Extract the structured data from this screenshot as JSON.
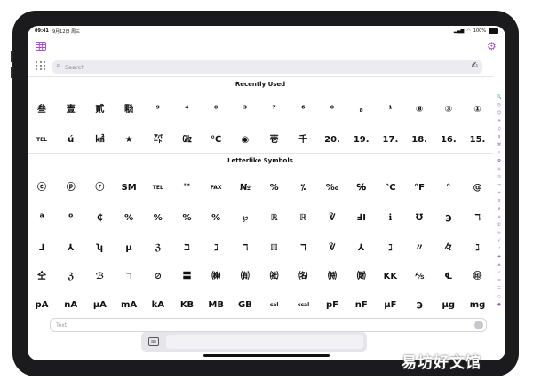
{
  "status_bar": {
    "time": "09:41",
    "date": "9月12日 周三",
    "battery": "100%"
  },
  "toolbar": {
    "left_icon": "table-icon",
    "right_icon": "gear-icon"
  },
  "search": {
    "placeholder": "Search",
    "value": ""
  },
  "sections": [
    {
      "title": "Recently Used",
      "rows": [
        [
          "叁",
          "壹",
          "貳",
          "㍾",
          "⁹",
          "⁴",
          "⁸",
          "³",
          "⁷",
          "⁶",
          "⁰",
          "₈",
          "¹",
          "⑧",
          "③",
          "①"
        ],
        [
          "TEL",
          "ú",
          "㎢",
          "★",
          "㌀",
          "㎓",
          "℃",
          "◉",
          "壱",
          "千",
          "20.",
          "19.",
          "17.",
          "18.",
          "16.",
          "15."
        ]
      ]
    },
    {
      "title": "Letterlike Symbols",
      "rows": [
        [
          "ⓒ",
          "ⓟ",
          "ⓡ",
          "SM",
          "TEL",
          "™",
          "FAX",
          "№",
          "%",
          "⁒",
          "‰",
          "℅",
          "°C",
          "°F",
          "°",
          "@"
        ],
        [
          "ª",
          "º",
          "₵",
          "%",
          "%",
          "%",
          "%",
          "℘",
          "ℝ",
          "ℝ",
          "℣",
          "ℲI",
          "ℹ",
          "℧",
          "℈",
          "ℸ"
        ],
        [
          "⅃",
          "⅄",
          "ʮ",
          "µ",
          "ℨ",
          "ℶ",
          "ℷ",
          "ℸ",
          "ℿ",
          "ℸ",
          "℣",
          "⅄",
          "ℷ",
          "〃",
          "々",
          "ℷ"
        ],
        [
          "仝",
          "ℨ",
          "ℬ",
          "ℸ",
          "⊘",
          "〓",
          "㈱",
          "㈲",
          "㈳",
          "㈴",
          "㈵",
          "㈶",
          "KK",
          "⅍",
          "℄",
          "㊞"
        ],
        [
          "pA",
          "nA",
          "µA",
          "mA",
          "kA",
          "KB",
          "MB",
          "GB",
          "cal",
          "kcal",
          "pF",
          "nF",
          "µF",
          "℈",
          "µg",
          "mg"
        ]
      ]
    }
  ],
  "index_sidebar": [
    "🔍",
    "◷",
    "☺",
    "☀",
    "♫",
    "$",
    "⌘",
    "♯",
    "✿",
    "Ⓐ",
    "①",
    "→",
    "+",
    "π",
    "∂",
    "⌂",
    "©",
    "∞",
    "√",
    "♪",
    "◆",
    "▲",
    "✓",
    "≡",
    "☰",
    "○",
    "●"
  ],
  "text_input": {
    "placeholder": "Text",
    "value": ""
  },
  "watermark": "易坊好文馆"
}
